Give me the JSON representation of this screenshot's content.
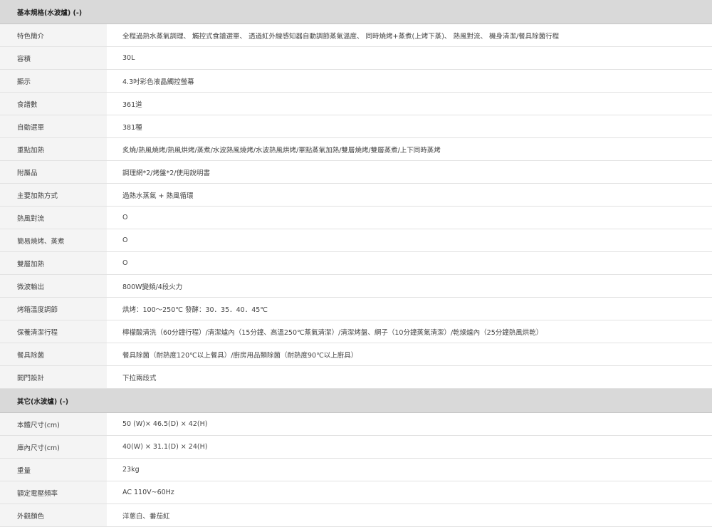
{
  "sections": [
    {
      "title": "基本規格(水波爐) (-)",
      "rows": [
        {
          "label": "特色簡介",
          "value": "全程過熱水蒸氣調理、 觸控式食譜選單、 透過紅外線感知器自動調節蒸氣溫度、 同時燒烤+蒸煮(上烤下蒸)、 熱風對流、 機身清潔/餐具除菌行程"
        },
        {
          "label": "容積",
          "value": "30L"
        },
        {
          "label": "顯示",
          "value": "4.3吋彩色液晶觸控螢幕"
        },
        {
          "label": "食譜數",
          "value": "361道"
        },
        {
          "label": "自動選單",
          "value": "381種"
        },
        {
          "label": "重點加熱",
          "value": "炙燒/熱風燒烤/熱風烘烤/蒸煮/水波熱風燒烤/水波熱風烘烤/單點蒸氣加熱/雙層燒烤/雙層蒸煮/上下同時蒸烤"
        },
        {
          "label": "附屬品",
          "value": "調理網*2/烤盤*2/使用說明書"
        },
        {
          "label": "主要加熱方式",
          "value": "過熱水蒸氣 + 熱風循環"
        },
        {
          "label": "熱風對流",
          "value": "O"
        },
        {
          "label": "簡易燒烤、蒸煮",
          "value": "O"
        },
        {
          "label": "雙層加熱",
          "value": "O"
        },
        {
          "label": "微波輸出",
          "value": "800W變頻/4段火力"
        },
        {
          "label": "烤箱溫度調節",
          "value": "烘烤：100～250℃ 發酵：30．35．40．45℃"
        },
        {
          "label": "保養清潔行程",
          "value": "檸檬酸清洗（60分鐘行程）/清潔爐內（15分鐘、高溫250℃蒸氣清潔）/清潔烤盤、網子（10分鐘蒸氣清潔）/乾燥爐內（25分鐘熱風烘乾）"
        },
        {
          "label": "餐具除菌",
          "value": "餐具除菌（耐熱度120℃以上餐具）/廚房用品類除菌（耐熱度90℃以上廚具）"
        },
        {
          "label": "開門設計",
          "value": "下拉兩段式"
        }
      ]
    },
    {
      "title": "其它(水波爐) (-)",
      "rows": [
        {
          "label": "本體尺寸(cm)",
          "value": "50 (W)× 46.5(D) × 42(H)"
        },
        {
          "label": "庫內尺寸(cm)",
          "value": "40(W) × 31.1(D) × 24(H)"
        },
        {
          "label": "重量",
          "value": "23kg"
        },
        {
          "label": "額定電壓頻率",
          "value": "AC 110V~60Hz"
        },
        {
          "label": "外觀顏色",
          "value": "洋蔥白、番茄紅"
        }
      ]
    }
  ]
}
